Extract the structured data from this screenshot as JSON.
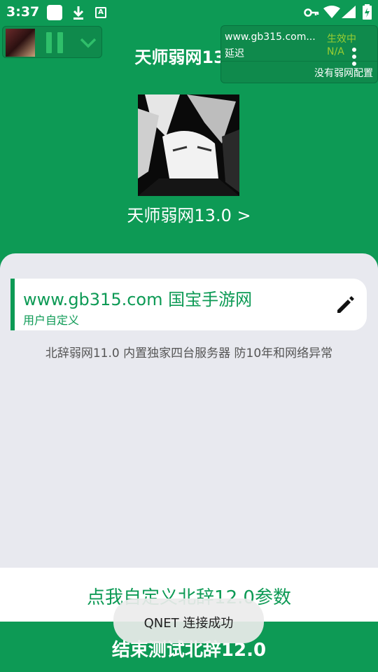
{
  "status_bar": {
    "time": "3:37",
    "icons": [
      "notification-square-icon",
      "download-icon",
      "a-badge-icon",
      "vpn-key-icon",
      "wifi-icon",
      "signal-icon",
      "battery-charging-icon"
    ]
  },
  "app": {
    "title": "天师弱网13.0"
  },
  "overlay": {
    "url": "www.gb315.com...",
    "delay_label": "延迟",
    "status": "生效中",
    "value": "N/A",
    "no_config": "没有弱网配置",
    "status_color": "#9acd32"
  },
  "profile": {
    "link_text": "天师弱网13.0 >"
  },
  "card": {
    "title": "www.gb315.com 国宝手游网",
    "subtitle": "用户自定义"
  },
  "description": "北辞弱网11.0 内置独家四台服务器 防10年和网络异常",
  "buttons": {
    "customize": "点我自定义北辞12.0参数",
    "end_test": "结束测试北辞12.0"
  },
  "toast": {
    "message": "QNET 连接成功"
  },
  "colors": {
    "primary": "#0d9a55",
    "panel_bg": "#e8e9ef"
  }
}
